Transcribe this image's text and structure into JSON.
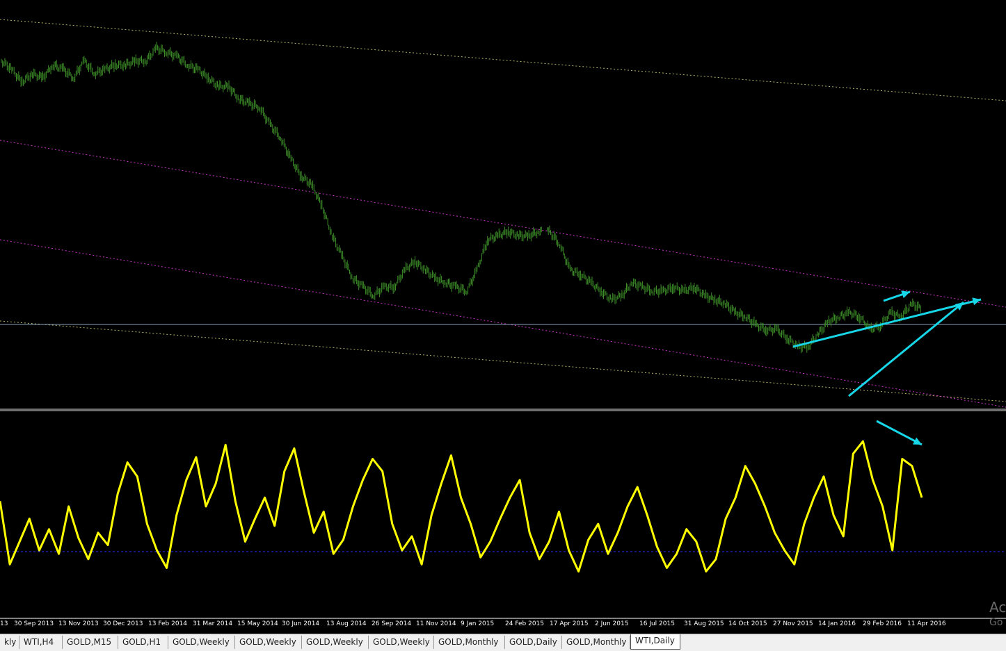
{
  "chart_data": [
    {
      "type": "line",
      "panel": "price",
      "symbol": "WTI,Daily",
      "description_free": true,
      "x_dates": [
        "30 Sep 2013",
        "13 Nov 2013",
        "30 Dec 2013",
        "13 Feb 2014",
        "31 Mar 2014",
        "15 May 2014",
        "30 Jun 2014",
        "13 Aug 2014",
        "26 Sep 2014",
        "11 Nov 2014",
        "9 Jan 2015",
        "24 Feb 2015",
        "17 Apr 2015",
        "2 Jun 2015",
        "16 Jul 2015",
        "31 Aug 2015",
        "14 Oct 2015",
        "27 Nov 2015",
        "14 Jan 2016",
        "29 Feb 2016",
        "11 Apr 2016"
      ],
      "series": [
        {
          "values": [
            101,
            99,
            96,
            98,
            97,
            100,
            99,
            97,
            101,
            98,
            99,
            100,
            100,
            101,
            101,
            104,
            103,
            102,
            100,
            99,
            97,
            95,
            95,
            92,
            91,
            90,
            86,
            83,
            78,
            74,
            72,
            67,
            60,
            55,
            50,
            48,
            46,
            48,
            48,
            52,
            54,
            52,
            50,
            49,
            48,
            47,
            52,
            59,
            60,
            61,
            60,
            60,
            61,
            61,
            58,
            52,
            51,
            49,
            47,
            45,
            46,
            49,
            48,
            47,
            47,
            48,
            47,
            48,
            46,
            45,
            44,
            42,
            41,
            39,
            38,
            38,
            36,
            34,
            34,
            37,
            40,
            41,
            42,
            41,
            38,
            39,
            42,
            41,
            44,
            43
          ]
        }
      ],
      "ylim": [
        20,
        112
      ],
      "annotation_lines": [
        {
          "kind": "dotted",
          "color": "#b0b060"
        },
        {
          "kind": "dotted",
          "color": "#b0b060"
        },
        {
          "kind": "dotted",
          "color": "#c040c0"
        },
        {
          "kind": "dotted",
          "color": "#c040c0"
        },
        {
          "kind": "solid",
          "color": "#8aa0b8"
        }
      ]
    },
    {
      "type": "line",
      "panel": "oscillator",
      "series": [
        {
          "values": [
            58,
            22,
            35,
            48,
            30,
            42,
            28,
            55,
            37,
            25,
            40,
            33,
            62,
            80,
            72,
            45,
            30,
            20,
            50,
            70,
            83,
            55,
            68,
            90,
            58,
            35,
            48,
            60,
            44,
            75,
            88,
            63,
            40,
            52,
            28,
            36,
            55,
            70,
            82,
            75,
            45,
            30,
            38,
            22,
            50,
            68,
            84,
            60,
            45,
            26,
            35,
            48,
            60,
            70,
            40,
            25,
            35,
            52,
            30,
            18,
            36,
            45,
            28,
            40,
            55,
            66,
            50,
            32,
            20,
            28,
            42,
            35,
            18,
            25,
            48,
            60,
            78,
            68,
            55,
            40,
            30,
            22,
            45,
            60,
            72,
            50,
            38,
            85,
            92,
            70,
            55,
            30,
            82,
            78,
            60
          ],
          "color": "#ffff00"
        }
      ],
      "ylim": [
        0,
        100
      ],
      "reference_line": 33
    }
  ],
  "tabs": [
    {
      "label": "kly"
    },
    {
      "label": "WTI,H4"
    },
    {
      "label": "GOLD,M15"
    },
    {
      "label": "GOLD,H1"
    },
    {
      "label": "GOLD,Weekly"
    },
    {
      "label": "GOLD,Weekly"
    },
    {
      "label": "GOLD,Weekly"
    },
    {
      "label": "GOLD,Weekly"
    },
    {
      "label": "GOLD,Monthly"
    },
    {
      "label": "GOLD,Daily"
    },
    {
      "label": "GOLD,Monthly"
    },
    {
      "label": "WTI,Daily",
      "active": true
    }
  ],
  "left_edge_date": "13",
  "watermark": {
    "line1": "Ac",
    "line2": "Go"
  },
  "colors": {
    "background": "#000000",
    "price": "#3c8c28",
    "oscillator": "#ffff00",
    "arrows": "#17d6e8",
    "magenta_channel": "#cc33cc",
    "olive_channel": "#b5b56a",
    "horizontal_level": "#8aa0b8",
    "ref_line": "#2a2aff"
  }
}
